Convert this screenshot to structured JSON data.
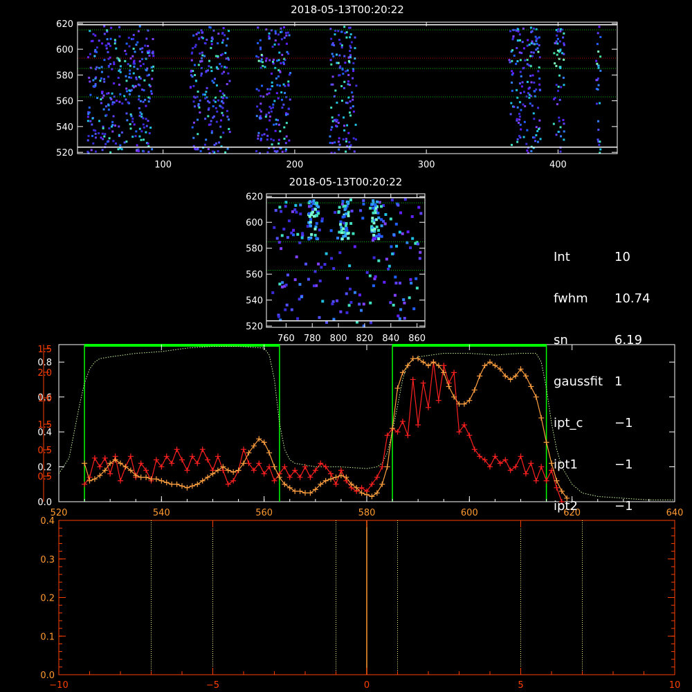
{
  "colors": {
    "background": "#000000",
    "axis": "#ffffff",
    "green_dotted": "#00c000",
    "red_dotted": "#c00000",
    "green_box": "#00ff00",
    "profile_dotted": "#d0ffa0",
    "red_series": "#ff2020",
    "orange_series": "#ffa040",
    "axis_red": "#ff4000",
    "orange_axis": "#ff9a30",
    "vline_dotted": "#ffff80"
  },
  "top_image": {
    "title": "2018-05-13T00:20:22",
    "x_ticks": [
      "100",
      "200",
      "300",
      "400"
    ],
    "y_ticks": [
      "520",
      "540",
      "560",
      "580",
      "600",
      "620"
    ]
  },
  "middle_image": {
    "title": "2018-05-13T00:20:22",
    "x_ticks": [
      "760",
      "780",
      "800",
      "820",
      "840",
      "860"
    ],
    "y_ticks": [
      "520",
      "540",
      "560",
      "580",
      "600",
      "620"
    ]
  },
  "info_panel": [
    {
      "key": "Int",
      "value": "10"
    },
    {
      "key": "fwhm",
      "value": "10.74"
    },
    {
      "key": "sn",
      "value": "6.19"
    },
    {
      "key": "gaussfit",
      "value": "1"
    },
    {
      "key": "ipt_c",
      "value": "−1"
    },
    {
      "key": "ipt1",
      "value": "−1"
    },
    {
      "key": "ipt2",
      "value": "−1"
    }
  ],
  "chart_data": [
    {
      "type": "heatmap",
      "title": "2018-05-13T00:20:22",
      "xlim": [
        35,
        445
      ],
      "ylim": [
        519,
        621
      ],
      "x_ticks": [
        100,
        200,
        300,
        400
      ],
      "y_ticks": [
        520,
        540,
        560,
        580,
        600,
        620
      ],
      "column_bands": [
        [
          42,
          92
        ],
        [
          120,
          150
        ],
        [
          170,
          196
        ],
        [
          226,
          246
        ],
        [
          362,
          386
        ],
        [
          396,
          404
        ],
        [
          428,
          432
        ]
      ],
      "horizontal_lines": {
        "white": [
          524,
          619
        ],
        "green_dotted": [
          563,
          585,
          615
        ],
        "red_dotted": [
          593
        ]
      }
    },
    {
      "type": "heatmap",
      "title": "2018-05-13T00:20:22",
      "xlim": [
        745,
        866
      ],
      "ylim": [
        519,
        622
      ],
      "x_ticks": [
        760,
        780,
        800,
        820,
        840,
        860
      ],
      "y_ticks": [
        520,
        540,
        560,
        580,
        600,
        620
      ],
      "horizontal_lines": {
        "white": [
          524,
          619
        ],
        "green_dotted": [
          563,
          585,
          615
        ]
      }
    },
    {
      "type": "line",
      "xlim": [
        520,
        640
      ],
      "x_ticks": [
        520,
        540,
        560,
        580,
        600,
        620,
        640
      ],
      "left_axis_white": {
        "ylim": [
          0,
          0.9
        ],
        "ticks": [
          "0.0",
          "0.2",
          "0.4",
          "0.6",
          "0.8"
        ]
      },
      "left_axis_red": {
        "labels": [
          "0.5",
          "0.5",
          "1.5",
          "1.0",
          "2.0",
          "1.5"
        ]
      },
      "windows": [
        [
          525,
          563
        ],
        [
          585,
          615
        ]
      ],
      "profile_dotted": {
        "x": [
          520,
          522,
          523,
          524,
          525,
          526,
          527,
          528,
          530,
          535,
          540,
          545,
          550,
          555,
          560,
          561,
          562,
          563,
          564,
          565,
          566,
          570,
          575,
          580,
          582,
          583,
          584,
          585,
          586,
          587,
          588,
          590,
          595,
          600,
          605,
          610,
          613,
          614,
          615,
          616,
          617,
          618,
          620,
          622,
          625,
          630,
          635,
          640
        ],
        "y": [
          0.16,
          0.25,
          0.4,
          0.55,
          0.68,
          0.76,
          0.8,
          0.82,
          0.83,
          0.85,
          0.86,
          0.88,
          0.89,
          0.89,
          0.88,
          0.84,
          0.7,
          0.45,
          0.3,
          0.24,
          0.22,
          0.2,
          0.2,
          0.19,
          0.2,
          0.22,
          0.28,
          0.4,
          0.55,
          0.7,
          0.79,
          0.83,
          0.85,
          0.85,
          0.84,
          0.85,
          0.85,
          0.8,
          0.65,
          0.45,
          0.3,
          0.2,
          0.1,
          0.05,
          0.03,
          0.02,
          0.01,
          0.01
        ]
      },
      "series": [
        {
          "color": "red",
          "x": [
            525,
            526,
            527,
            528,
            529,
            530,
            531,
            532,
            533,
            534,
            535,
            536,
            537,
            538,
            539,
            540,
            541,
            542,
            543,
            544,
            545,
            546,
            547,
            548,
            549,
            550,
            551,
            552,
            553,
            554,
            555,
            556,
            557,
            558,
            559,
            560,
            561,
            562,
            563,
            564,
            565,
            566,
            567,
            568,
            569,
            570,
            571,
            572,
            573,
            574,
            575,
            576,
            577,
            578,
            579,
            580,
            581,
            582,
            583,
            584,
            585,
            586,
            587,
            588,
            589,
            590,
            591,
            592,
            593,
            594,
            595,
            596,
            597,
            598,
            599,
            600,
            601,
            602,
            603,
            604,
            605,
            606,
            607,
            608,
            609,
            610,
            611,
            612,
            613,
            614,
            615,
            616,
            617,
            618
          ],
          "y": [
            0.1,
            0.14,
            0.25,
            0.2,
            0.25,
            0.16,
            0.26,
            0.12,
            0.2,
            0.26,
            0.14,
            0.22,
            0.18,
            0.12,
            0.24,
            0.2,
            0.26,
            0.22,
            0.3,
            0.24,
            0.18,
            0.26,
            0.22,
            0.3,
            0.24,
            0.18,
            0.26,
            0.18,
            0.1,
            0.12,
            0.18,
            0.3,
            0.22,
            0.18,
            0.22,
            0.16,
            0.2,
            0.12,
            0.16,
            0.2,
            0.14,
            0.18,
            0.14,
            0.2,
            0.14,
            0.18,
            0.22,
            0.2,
            0.16,
            0.1,
            0.18,
            0.12,
            0.08,
            0.06,
            0.08,
            0.06,
            0.1,
            0.14,
            0.2,
            0.38,
            0.42,
            0.4,
            0.46,
            0.38,
            0.7,
            0.44,
            0.68,
            0.54,
            0.8,
            0.58,
            0.78,
            0.68,
            0.74,
            0.4,
            0.44,
            0.38,
            0.3,
            0.26,
            0.24,
            0.2,
            0.26,
            0.22,
            0.24,
            0.18,
            0.2,
            0.26,
            0.16,
            0.22,
            0.12,
            0.2,
            0.12,
            0.18,
            0.08,
            0.0
          ]
        },
        {
          "color": "orange",
          "x": [
            525,
            526,
            527,
            528,
            529,
            530,
            531,
            532,
            533,
            534,
            535,
            536,
            537,
            538,
            539,
            540,
            541,
            542,
            543,
            544,
            545,
            546,
            547,
            548,
            549,
            550,
            551,
            552,
            553,
            554,
            555,
            556,
            557,
            558,
            559,
            560,
            561,
            562,
            563,
            564,
            565,
            566,
            567,
            568,
            569,
            570,
            571,
            572,
            573,
            574,
            575,
            576,
            577,
            578,
            579,
            580,
            581,
            582,
            583,
            584,
            585,
            586,
            587,
            588,
            589,
            590,
            591,
            592,
            593,
            594,
            595,
            596,
            597,
            598,
            599,
            600,
            601,
            602,
            603,
            604,
            605,
            606,
            607,
            608,
            609,
            610,
            611,
            612,
            613,
            614,
            615,
            616,
            617,
            618,
            619
          ],
          "y": [
            0.22,
            0.12,
            0.13,
            0.15,
            0.18,
            0.22,
            0.24,
            0.22,
            0.2,
            0.18,
            0.15,
            0.14,
            0.14,
            0.13,
            0.13,
            0.12,
            0.11,
            0.1,
            0.1,
            0.09,
            0.08,
            0.09,
            0.1,
            0.12,
            0.14,
            0.16,
            0.18,
            0.2,
            0.18,
            0.17,
            0.18,
            0.22,
            0.28,
            0.32,
            0.36,
            0.34,
            0.28,
            0.2,
            0.14,
            0.1,
            0.08,
            0.06,
            0.06,
            0.05,
            0.05,
            0.07,
            0.1,
            0.12,
            0.13,
            0.14,
            0.15,
            0.14,
            0.1,
            0.08,
            0.05,
            0.04,
            0.03,
            0.05,
            0.1,
            0.2,
            0.42,
            0.65,
            0.74,
            0.78,
            0.82,
            0.82,
            0.8,
            0.78,
            0.8,
            0.78,
            0.74,
            0.66,
            0.6,
            0.56,
            0.56,
            0.58,
            0.64,
            0.72,
            0.78,
            0.8,
            0.78,
            0.76,
            0.72,
            0.7,
            0.72,
            0.76,
            0.72,
            0.66,
            0.6,
            0.48,
            0.34,
            0.22,
            0.12,
            0.06,
            0.02
          ]
        }
      ]
    },
    {
      "type": "line",
      "xlim": [
        -10,
        10
      ],
      "ylim": [
        0,
        0.4
      ],
      "x_ticks": [
        "−10",
        "−5",
        "0",
        "5",
        "10"
      ],
      "y_ticks": [
        "0.0",
        "0.1",
        "0.2",
        "0.3",
        "0.4"
      ],
      "vertical_dotted_lines": [
        -7,
        -5,
        -1,
        1,
        5,
        7
      ],
      "vertical_solid_line": 0
    }
  ]
}
